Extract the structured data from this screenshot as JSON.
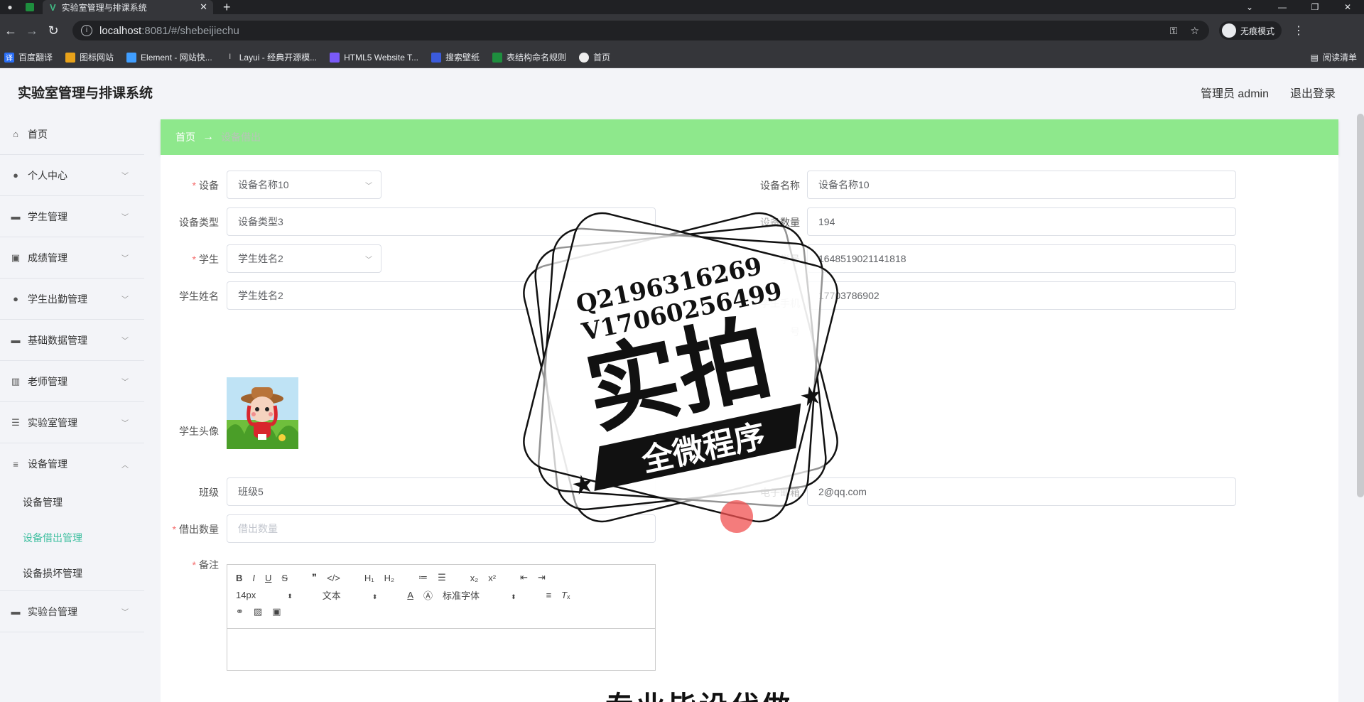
{
  "browser": {
    "tab_title": "实验室管理与排课系统",
    "url_host": "localhost",
    "url_path": ":8081/#/shebeijiechu",
    "profile_label": "无痕模式",
    "bookmarks": [
      "百度翻译",
      "图标网站",
      "Element - 网站快...",
      "Layui - 经典开源模...",
      "HTML5 Website T...",
      "搜索壁纸",
      "表结构命名规则",
      "首页"
    ],
    "reading_list": "阅读清单"
  },
  "app": {
    "title": "实验室管理与排课系统",
    "user_label": "管理员 admin",
    "logout_label": "退出登录"
  },
  "sidebar": {
    "items": [
      {
        "label": "首页",
        "icon": "home-icon"
      },
      {
        "label": "个人中心",
        "icon": "user-icon"
      },
      {
        "label": "学生管理",
        "icon": "tool-icon"
      },
      {
        "label": "成绩管理",
        "icon": "clipboard-icon"
      },
      {
        "label": "学生出勤管理",
        "icon": "user-icon"
      },
      {
        "label": "基础数据管理",
        "icon": "box-icon"
      },
      {
        "label": "老师管理",
        "icon": "library-icon"
      },
      {
        "label": "实验室管理",
        "icon": "list-icon"
      },
      {
        "label": "设备管理",
        "icon": "sliders-icon"
      },
      {
        "label": "实验台管理",
        "icon": "bench-icon"
      }
    ],
    "subitems": [
      {
        "label": "设备管理"
      },
      {
        "label": "设备借出管理"
      },
      {
        "label": "设备损坏管理"
      }
    ]
  },
  "breadcrumb": {
    "home": "首页",
    "arrow": "→",
    "current": "设备借出"
  },
  "form": {
    "device_label": "设备",
    "device_value": "设备名称10",
    "device_name_label": "设备名称",
    "device_name_value": "设备名称10",
    "device_type_label": "设备类型",
    "device_type_value": "设备类型3",
    "device_count_label": "设备数量",
    "device_count_value": "194",
    "student_label": "学生",
    "student_value": "学生姓名2",
    "student_no_label": "学号",
    "student_no_value": "1648519021141818",
    "student_name_label": "学生姓名",
    "student_name_value": "学生姓名2",
    "student_phone_label_1": "学生手机",
    "student_phone_label_2": "号",
    "student_phone_value": "17703786902",
    "student_avatar_label": "学生头像",
    "class_label": "班级",
    "class_value": "班级5",
    "email_label": "电子邮箱",
    "email_value": "2@qq.com",
    "lend_count_label": "借出数量",
    "lend_count_placeholder": "借出数量",
    "remark_label": "备注"
  },
  "editor": {
    "font_size": "14px",
    "paragraph": "文本",
    "font_family": "标准字体"
  },
  "watermark": {
    "line1": "Q2196316269",
    "line2": "V17060256499",
    "main": "实拍",
    "ribbon": "全微程序",
    "bottom_text": "专业毕设代做"
  }
}
